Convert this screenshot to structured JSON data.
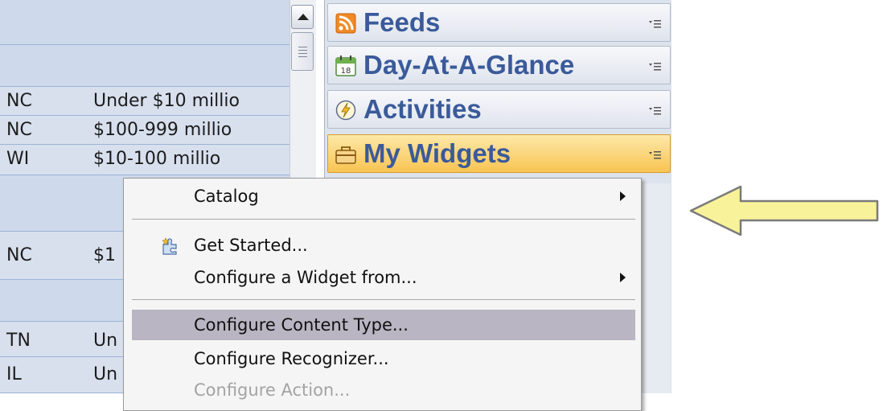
{
  "table": {
    "rows": [
      {
        "type": "group"
      },
      {
        "type": "group"
      },
      {
        "type": "data",
        "state": "NC",
        "revenue": "Under $10 millio"
      },
      {
        "type": "data",
        "state": "NC",
        "revenue": "$100-999 millio"
      },
      {
        "type": "data",
        "state": "WI",
        "revenue": "$10-100 millio"
      },
      {
        "type": "group"
      },
      {
        "type": "data",
        "state": "NC",
        "revenue": "$1"
      },
      {
        "type": "group"
      },
      {
        "type": "data",
        "state": "TN",
        "revenue": "Un"
      },
      {
        "type": "data",
        "state": "IL",
        "revenue": "Un"
      }
    ]
  },
  "sidebar": {
    "panels": [
      {
        "label": "Feeds",
        "icon": "rss-feed-icon",
        "active": false
      },
      {
        "label": "Day-At-A-Glance",
        "icon": "calendar-icon",
        "active": false
      },
      {
        "label": "Activities",
        "icon": "activity-bolt-icon",
        "active": false
      },
      {
        "label": "My Widgets",
        "icon": "widget-toolbox-icon",
        "active": true
      }
    ]
  },
  "context_menu": {
    "items": [
      {
        "label": "Catalog",
        "submenu": true
      },
      {
        "label": "Get Started...",
        "icon": "puzzle-star-icon"
      },
      {
        "label": "Configure a Widget from...",
        "submenu": true
      },
      {
        "label": "Configure Content Type...",
        "highlighted": true
      },
      {
        "label": "Configure Recognizer..."
      },
      {
        "label": "Configure Action...",
        "disabled": true
      }
    ]
  },
  "colors": {
    "active_panel": "#f8c452",
    "panel_text": "#3a5a9a",
    "menu_highlight": "#b9b5c3",
    "callout_arrow_fill": "#f8f39a",
    "callout_arrow_stroke": "#7a7a7a"
  }
}
